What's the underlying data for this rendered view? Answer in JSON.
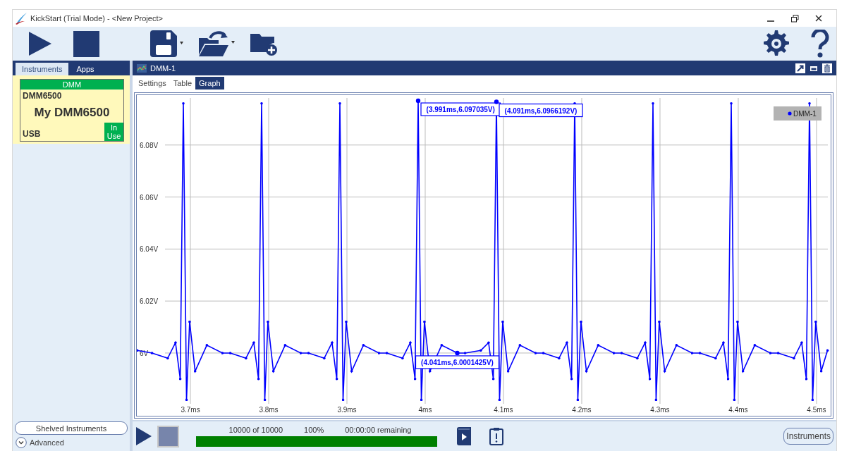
{
  "window": {
    "title": "KickStart (Trial Mode) - <New Project>"
  },
  "sidebar": {
    "tabs": [
      {
        "label": "Instruments",
        "selected": true
      },
      {
        "label": "Apps",
        "selected": false
      }
    ],
    "instruments": [
      {
        "type": "DMM",
        "model": "DMM6500",
        "name": "My DMM6500",
        "connection": "USB",
        "status": "In Use"
      }
    ],
    "shelved_button": "Shelved Instruments",
    "advanced": {
      "label": "Advanced",
      "expanded": false
    }
  },
  "panel": {
    "title": "DMM-1",
    "tabs": [
      {
        "label": "Settings",
        "selected": false
      },
      {
        "label": "Table",
        "selected": false
      },
      {
        "label": "Graph",
        "selected": true
      }
    ],
    "graph": {
      "chart_data": {
        "type": "line",
        "x": [
          3.632,
          3.651,
          3.671,
          3.681,
          3.687,
          3.691,
          3.695,
          3.699,
          3.706,
          3.721,
          3.741,
          3.751,
          3.771,
          3.781,
          3.787,
          3.791,
          3.795,
          3.799,
          3.806,
          3.821,
          3.841,
          3.851,
          3.871,
          3.881,
          3.887,
          3.891,
          3.895,
          3.899,
          3.906,
          3.921,
          3.941,
          3.951,
          3.971,
          3.981,
          3.987,
          3.991,
          3.995,
          3.999,
          4.006,
          4.021,
          4.041,
          4.051,
          4.071,
          4.081,
          4.087,
          4.091,
          4.095,
          4.099,
          4.106,
          4.121,
          4.141,
          4.151,
          4.171,
          4.181,
          4.187,
          4.191,
          4.195,
          4.199,
          4.206,
          4.221,
          4.241,
          4.251,
          4.271,
          4.281,
          4.287,
          4.291,
          4.295,
          4.299,
          4.306,
          4.321,
          4.341,
          4.351,
          4.371,
          4.381,
          4.387,
          4.391,
          4.395,
          4.399,
          4.406,
          4.421,
          4.441,
          4.451,
          4.471,
          4.481,
          4.487,
          4.491,
          4.495,
          4.499,
          4.506,
          4.514
        ],
        "series": [
          {
            "name": "DMM-1",
            "color": "#0000ff",
            "values": [
              6.001,
              6.0,
              5.998,
              6.004,
              5.99,
              6.096,
              5.982,
              6.012,
              5.993,
              6.003,
              6.0,
              6.0,
              5.998,
              6.004,
              5.99,
              6.096,
              5.982,
              6.012,
              5.993,
              6.003,
              6.0,
              6.0,
              5.998,
              6.004,
              5.99,
              6.096,
              5.982,
              6.012,
              5.993,
              6.003,
              6.0,
              6.0,
              5.998,
              6.004,
              5.99,
              6.097,
              5.982,
              6.012,
              5.993,
              6.003,
              6.0,
              6.0,
              6.001,
              6.004,
              5.99,
              6.0966,
              5.982,
              6.012,
              5.993,
              6.003,
              6.0,
              6.0,
              5.998,
              6.004,
              5.99,
              6.096,
              5.982,
              6.012,
              5.993,
              6.003,
              6.0,
              6.0,
              5.998,
              6.004,
              5.99,
              6.096,
              5.982,
              6.012,
              5.993,
              6.003,
              6.0,
              6.0,
              5.998,
              6.004,
              5.99,
              6.096,
              5.982,
              6.012,
              5.993,
              6.003,
              6.0,
              6.0,
              5.998,
              6.004,
              5.99,
              6.096,
              5.982,
              6.012,
              5.993,
              6.001
            ]
          }
        ],
        "grid": true,
        "xlim": [
          3.6315,
          4.515
        ],
        "ylim": [
          5.976,
          6.1
        ],
        "xticks": [
          {
            "value": 3.7,
            "label": "3.7ms"
          },
          {
            "value": 3.8,
            "label": "3.8ms"
          },
          {
            "value": 3.9,
            "label": "3.9ms"
          },
          {
            "value": 4.0,
            "label": "4ms"
          },
          {
            "value": 4.1,
            "label": "4.1ms"
          },
          {
            "value": 4.2,
            "label": "4.2ms"
          },
          {
            "value": 4.3,
            "label": "4.3ms"
          },
          {
            "value": 4.4,
            "label": "4.4ms"
          },
          {
            "value": 4.5,
            "label": "4.5ms"
          }
        ],
        "yticks": [
          {
            "value": 6.0,
            "label": "6V"
          },
          {
            "value": 6.02,
            "label": "6.02V"
          },
          {
            "value": 6.04,
            "label": "6.04V"
          },
          {
            "value": 6.06,
            "label": "6.06V"
          },
          {
            "value": 6.08,
            "label": "6.08V"
          }
        ],
        "annotations": [
          {
            "x": 3.991,
            "y": 6.097,
            "text": "(3.991ms,6.097035V)"
          },
          {
            "x": 4.091,
            "y": 6.0966,
            "text": "(4.091ms,6.0966192V)"
          },
          {
            "x": 4.041,
            "y": 6.0,
            "text": "(4.041ms,6.0001425V)"
          }
        ]
      }
    }
  },
  "run_bar": {
    "count": "10000 of 10000",
    "percent": "100%",
    "remaining": "00:00:00 remaining",
    "level": 1,
    "instruments_button": "Instruments"
  }
}
